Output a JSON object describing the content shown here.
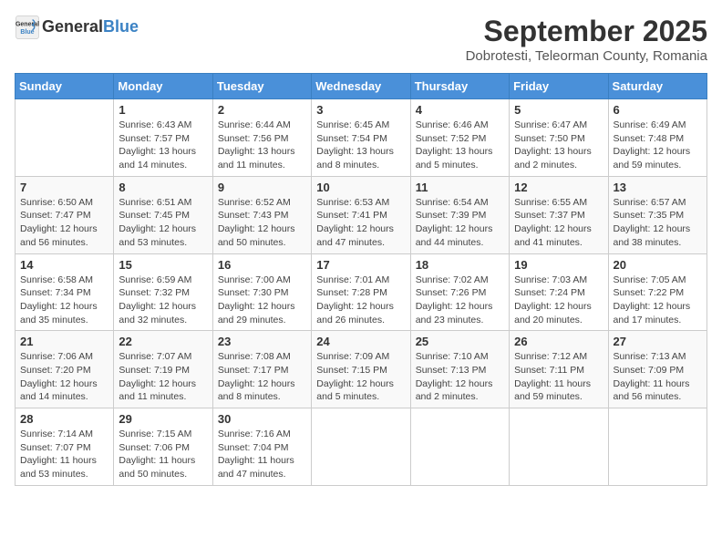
{
  "header": {
    "logo_general": "General",
    "logo_blue": "Blue",
    "title": "September 2025",
    "subtitle": "Dobrotesti, Teleorman County, Romania"
  },
  "weekdays": [
    "Sunday",
    "Monday",
    "Tuesday",
    "Wednesday",
    "Thursday",
    "Friday",
    "Saturday"
  ],
  "weeks": [
    [
      {
        "day": "",
        "info": ""
      },
      {
        "day": "1",
        "info": "Sunrise: 6:43 AM\nSunset: 7:57 PM\nDaylight: 13 hours\nand 14 minutes."
      },
      {
        "day": "2",
        "info": "Sunrise: 6:44 AM\nSunset: 7:56 PM\nDaylight: 13 hours\nand 11 minutes."
      },
      {
        "day": "3",
        "info": "Sunrise: 6:45 AM\nSunset: 7:54 PM\nDaylight: 13 hours\nand 8 minutes."
      },
      {
        "day": "4",
        "info": "Sunrise: 6:46 AM\nSunset: 7:52 PM\nDaylight: 13 hours\nand 5 minutes."
      },
      {
        "day": "5",
        "info": "Sunrise: 6:47 AM\nSunset: 7:50 PM\nDaylight: 13 hours\nand 2 minutes."
      },
      {
        "day": "6",
        "info": "Sunrise: 6:49 AM\nSunset: 7:48 PM\nDaylight: 12 hours\nand 59 minutes."
      }
    ],
    [
      {
        "day": "7",
        "info": "Sunrise: 6:50 AM\nSunset: 7:47 PM\nDaylight: 12 hours\nand 56 minutes."
      },
      {
        "day": "8",
        "info": "Sunrise: 6:51 AM\nSunset: 7:45 PM\nDaylight: 12 hours\nand 53 minutes."
      },
      {
        "day": "9",
        "info": "Sunrise: 6:52 AM\nSunset: 7:43 PM\nDaylight: 12 hours\nand 50 minutes."
      },
      {
        "day": "10",
        "info": "Sunrise: 6:53 AM\nSunset: 7:41 PM\nDaylight: 12 hours\nand 47 minutes."
      },
      {
        "day": "11",
        "info": "Sunrise: 6:54 AM\nSunset: 7:39 PM\nDaylight: 12 hours\nand 44 minutes."
      },
      {
        "day": "12",
        "info": "Sunrise: 6:55 AM\nSunset: 7:37 PM\nDaylight: 12 hours\nand 41 minutes."
      },
      {
        "day": "13",
        "info": "Sunrise: 6:57 AM\nSunset: 7:35 PM\nDaylight: 12 hours\nand 38 minutes."
      }
    ],
    [
      {
        "day": "14",
        "info": "Sunrise: 6:58 AM\nSunset: 7:34 PM\nDaylight: 12 hours\nand 35 minutes."
      },
      {
        "day": "15",
        "info": "Sunrise: 6:59 AM\nSunset: 7:32 PM\nDaylight: 12 hours\nand 32 minutes."
      },
      {
        "day": "16",
        "info": "Sunrise: 7:00 AM\nSunset: 7:30 PM\nDaylight: 12 hours\nand 29 minutes."
      },
      {
        "day": "17",
        "info": "Sunrise: 7:01 AM\nSunset: 7:28 PM\nDaylight: 12 hours\nand 26 minutes."
      },
      {
        "day": "18",
        "info": "Sunrise: 7:02 AM\nSunset: 7:26 PM\nDaylight: 12 hours\nand 23 minutes."
      },
      {
        "day": "19",
        "info": "Sunrise: 7:03 AM\nSunset: 7:24 PM\nDaylight: 12 hours\nand 20 minutes."
      },
      {
        "day": "20",
        "info": "Sunrise: 7:05 AM\nSunset: 7:22 PM\nDaylight: 12 hours\nand 17 minutes."
      }
    ],
    [
      {
        "day": "21",
        "info": "Sunrise: 7:06 AM\nSunset: 7:20 PM\nDaylight: 12 hours\nand 14 minutes."
      },
      {
        "day": "22",
        "info": "Sunrise: 7:07 AM\nSunset: 7:19 PM\nDaylight: 12 hours\nand 11 minutes."
      },
      {
        "day": "23",
        "info": "Sunrise: 7:08 AM\nSunset: 7:17 PM\nDaylight: 12 hours\nand 8 minutes."
      },
      {
        "day": "24",
        "info": "Sunrise: 7:09 AM\nSunset: 7:15 PM\nDaylight: 12 hours\nand 5 minutes."
      },
      {
        "day": "25",
        "info": "Sunrise: 7:10 AM\nSunset: 7:13 PM\nDaylight: 12 hours\nand 2 minutes."
      },
      {
        "day": "26",
        "info": "Sunrise: 7:12 AM\nSunset: 7:11 PM\nDaylight: 11 hours\nand 59 minutes."
      },
      {
        "day": "27",
        "info": "Sunrise: 7:13 AM\nSunset: 7:09 PM\nDaylight: 11 hours\nand 56 minutes."
      }
    ],
    [
      {
        "day": "28",
        "info": "Sunrise: 7:14 AM\nSunset: 7:07 PM\nDaylight: 11 hours\nand 53 minutes."
      },
      {
        "day": "29",
        "info": "Sunrise: 7:15 AM\nSunset: 7:06 PM\nDaylight: 11 hours\nand 50 minutes."
      },
      {
        "day": "30",
        "info": "Sunrise: 7:16 AM\nSunset: 7:04 PM\nDaylight: 11 hours\nand 47 minutes."
      },
      {
        "day": "",
        "info": ""
      },
      {
        "day": "",
        "info": ""
      },
      {
        "day": "",
        "info": ""
      },
      {
        "day": "",
        "info": ""
      }
    ]
  ]
}
